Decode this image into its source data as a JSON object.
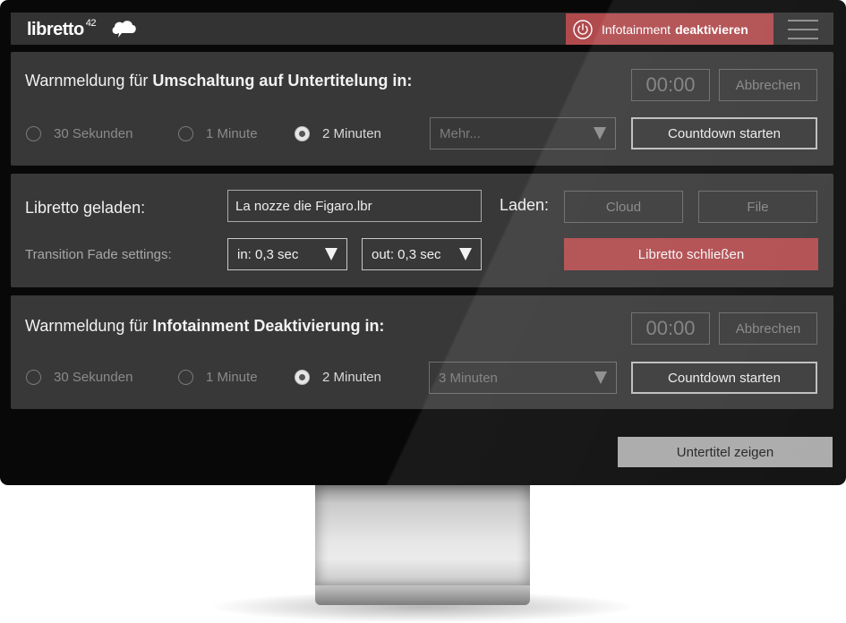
{
  "header": {
    "logo_text": "libretto",
    "logo_sup": "42",
    "deactivate_prefix": "Infotainment",
    "deactivate_bold": "deaktivieren"
  },
  "panel_subtitles": {
    "title_prefix": "Warnmeldung für",
    "title_bold": "Umschaltung auf Untertitelung in:",
    "timer": "00:00",
    "cancel_label": "Abbrechen",
    "radio_options": [
      "30 Sekunden",
      "1 Minute",
      "2 Minuten"
    ],
    "selected_option": "2 Minuten",
    "more_select_value": "Mehr...",
    "start_label": "Countdown starten"
  },
  "panel_libretto": {
    "loaded_label": "Libretto geladen:",
    "file_value": "La nozze die Figaro.lbr",
    "load_label": "Laden:",
    "cloud_label": "Cloud",
    "file_label": "File",
    "transition_label": "Transition Fade settings:",
    "fade_in_value": "in: 0,3 sec",
    "fade_out_value": "out: 0,3 sec",
    "close_label": "Libretto schließen"
  },
  "panel_infotainment": {
    "title_prefix": "Warnmeldung für",
    "title_bold": "Infotainment Deaktivierung in:",
    "timer": "00:00",
    "cancel_label": "Abbrechen",
    "radio_options": [
      "30 Sekunden",
      "1 Minute",
      "2 Minuten"
    ],
    "selected_option": "2 Minuten",
    "more_select_value": "3 Minuten",
    "start_label": "Countdown starten"
  },
  "footer": {
    "show_subtitles_label": "Untertitel zeigen"
  },
  "colors": {
    "accent_red": "#b04a4d",
    "panel": "#383838",
    "screen": "#080808"
  }
}
